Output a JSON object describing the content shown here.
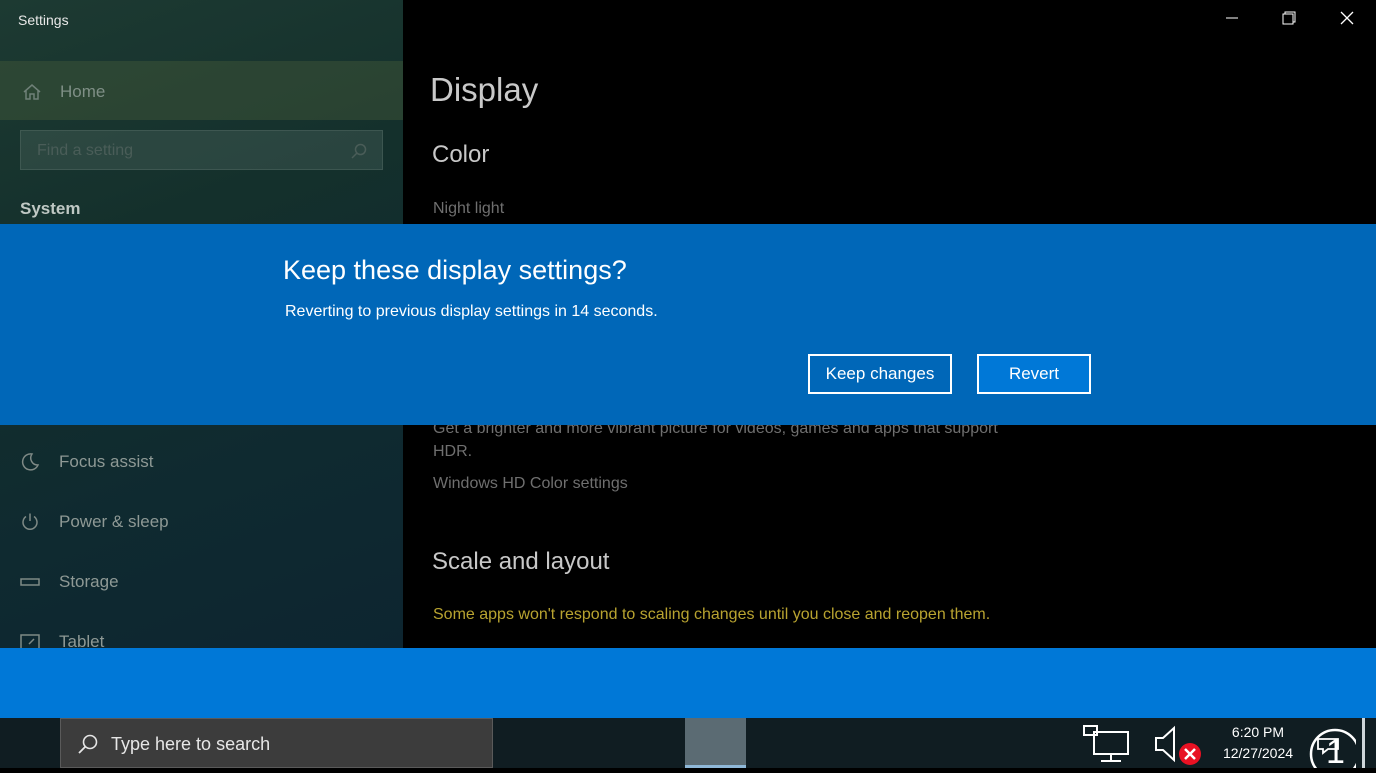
{
  "window": {
    "app_title": "Settings",
    "controls": {
      "minimize": "minimize",
      "maximize": "maximize",
      "close": "close"
    }
  },
  "sidebar": {
    "home_label": "Home",
    "search_placeholder": "Find a setting",
    "section_label": "System",
    "items": [
      {
        "label": "Focus assist",
        "icon": "moon-icon"
      },
      {
        "label": "Power & sleep",
        "icon": "power-icon"
      },
      {
        "label": "Storage",
        "icon": "storage-icon"
      },
      {
        "label": "Tablet",
        "icon": "tablet-icon"
      }
    ]
  },
  "content": {
    "page_title": "Display",
    "color_heading": "Color",
    "night_light_label": "Night light",
    "hdr_description": "Get a brighter and more vibrant picture for videos, games and apps that support HDR.",
    "hdr_link": "Windows HD Color settings",
    "scale_heading": "Scale and layout",
    "scale_warning": "Some apps won't respond to scaling changes until you close and reopen them."
  },
  "dialog": {
    "title": "Keep these display settings?",
    "message": "Reverting to previous display settings in 14 seconds.",
    "keep_label": "Keep changes",
    "revert_label": "Revert"
  },
  "taskbar": {
    "search_placeholder": "Type here to search",
    "time": "6:20 PM",
    "date": "12/27/2024",
    "notification_count": "1"
  },
  "colors": {
    "dialog_bg": "#0067b8",
    "accent": "#0078d7",
    "warning_text": "#b8a330"
  }
}
